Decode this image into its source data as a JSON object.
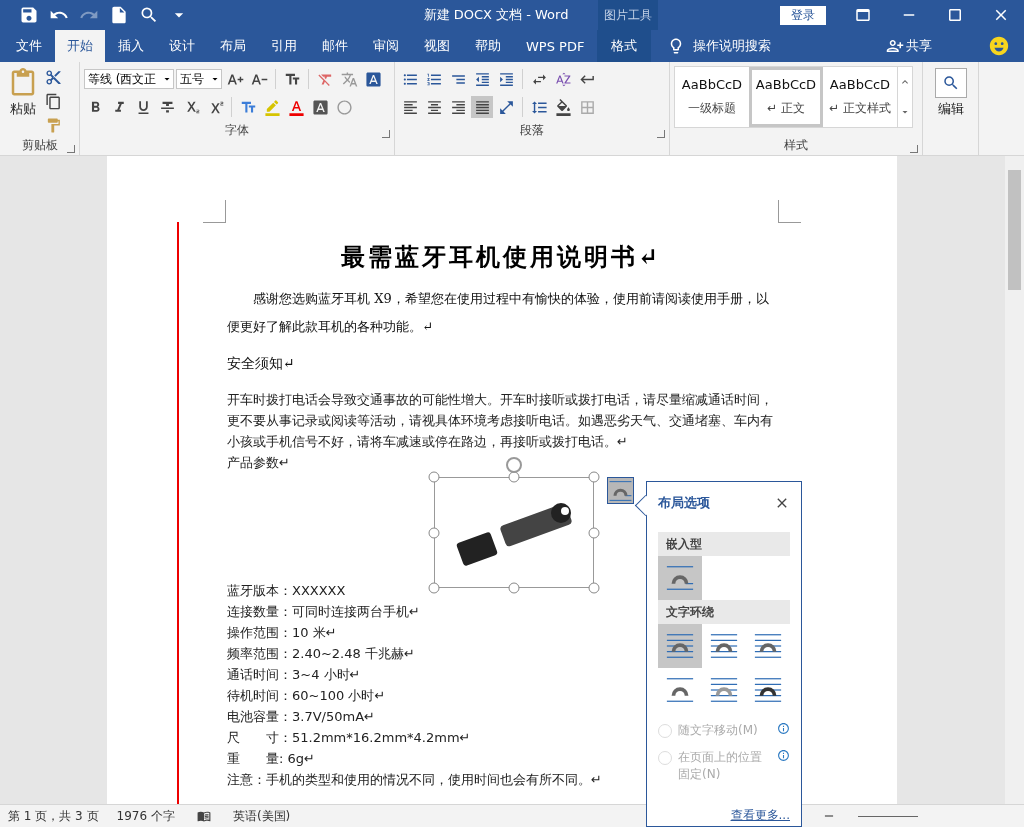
{
  "title_bar": {
    "title": "新建 DOCX 文档  -  Word",
    "context_label": "图片工具",
    "login": "登录"
  },
  "menu_tabs": [
    {
      "label": "文件",
      "selected": false,
      "kind": "normal"
    },
    {
      "label": "开始",
      "selected": true,
      "kind": "normal"
    },
    {
      "label": "插入",
      "selected": false,
      "kind": "normal"
    },
    {
      "label": "设计",
      "selected": false,
      "kind": "normal"
    },
    {
      "label": "布局",
      "selected": false,
      "kind": "normal"
    },
    {
      "label": "引用",
      "selected": false,
      "kind": "normal"
    },
    {
      "label": "邮件",
      "selected": false,
      "kind": "normal"
    },
    {
      "label": "审阅",
      "selected": false,
      "kind": "normal"
    },
    {
      "label": "视图",
      "selected": false,
      "kind": "normal"
    },
    {
      "label": "帮助",
      "selected": false,
      "kind": "normal"
    },
    {
      "label": "WPS PDF",
      "selected": false,
      "kind": "normal"
    },
    {
      "label": "格式",
      "selected": false,
      "kind": "context"
    }
  ],
  "tell_me": "操作说明搜索",
  "share": "共享",
  "ribbon": {
    "clipboard": {
      "paste": "粘贴",
      "group": "剪贴板"
    },
    "font": {
      "name": "等线 (西文正",
      "size": "五号",
      "group": "字体"
    },
    "paragraph": {
      "align_buttons": [
        {
          "kind": "left",
          "selected": false
        },
        {
          "kind": "center",
          "selected": false
        },
        {
          "kind": "right",
          "selected": false
        },
        {
          "kind": "justify",
          "selected": true
        }
      ],
      "group": "段落"
    },
    "styles": {
      "group": "样式",
      "items": [
        {
          "preview": "AaBbCcD",
          "label": "一级标题",
          "selected": false
        },
        {
          "preview": "AaBbCcD",
          "label": "↵ 正文",
          "selected": true
        },
        {
          "preview": "AaBbCcD",
          "label": "↵ 正文样式",
          "selected": false
        }
      ]
    },
    "editing": {
      "label": "编辑"
    }
  },
  "document": {
    "title": "最需蓝牙耳机使用说明书↵",
    "intro": "感谢您选购蓝牙耳机 X9，希望您在使用过程中有愉快的体验，使用前请阅读使用手册，以便更好了解此款耳机的各种功能。↵",
    "safety_heading": "安全须知↵",
    "safety_text": "开车时拨打电话会导致交通事故的可能性增大。开车时接听或拨打电话，请尽量缩减通话时间，更不要从事记录或阅读等活动，请视具体环境考虑接听电话。如遇恶劣天气、交通堵塞、车内有小孩或手机信号不好，请将车减速或停在路边，再接听或拨打电话。↵",
    "params_heading": "产品参数↵",
    "params": [
      "蓝牙版本：XXXXXX",
      "连接数量：可同时连接两台手机↵",
      "操作范围：10 米↵",
      "频率范围：2.40~2.48 千兆赫↵",
      "通话时间：3~4 小时↵",
      "待机时间：60~100 小时↵",
      "电池容量：3.7V/50mA↵",
      "尺　　寸：51.2mm*16.2mm*4.2mm↵",
      "重　　量: 6g↵",
      "注意：手机的类型和使用的情况不同，使用时间也会有所不同。↵"
    ]
  },
  "layout_panel": {
    "title": "布局选项",
    "sections": [
      {
        "heading": "嵌入型",
        "options": [
          {
            "kind": "inline",
            "selected": true
          }
        ]
      },
      {
        "heading": "文字环绕",
        "options": [
          {
            "kind": "square",
            "selected": true
          },
          {
            "kind": "tight",
            "selected": false
          },
          {
            "kind": "through",
            "selected": false
          },
          {
            "kind": "topbottom",
            "selected": false
          },
          {
            "kind": "behind",
            "selected": false
          },
          {
            "kind": "front",
            "selected": false
          }
        ]
      }
    ],
    "radios": [
      {
        "label": "随文字移动(M)",
        "checked": false,
        "disabled": true
      },
      {
        "label": "在页面上的位置固定(N)",
        "checked": false,
        "disabled": true
      }
    ],
    "link": "查看更多..."
  },
  "status_bar": {
    "page": "第 1 页，共 3 页",
    "words": "1976 个字",
    "language": "英语(美国)"
  }
}
